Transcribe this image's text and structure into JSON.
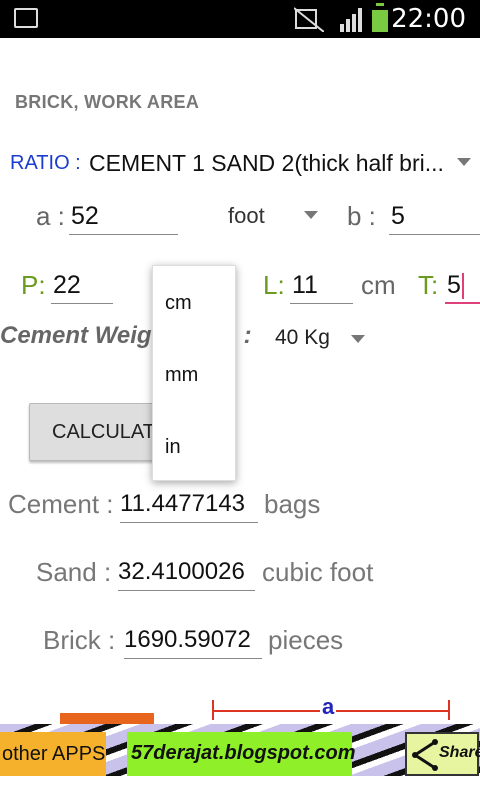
{
  "status_bar": {
    "time": "22:00",
    "battery_color": "#7ac943"
  },
  "title": "BRICK,   WORK AREA",
  "ratio": {
    "label": "RATIO :",
    "value": "CEMENT 1 SAND 2(thick half bri..."
  },
  "dimensions": {
    "a_label": "a :",
    "a_value": "52",
    "unit_value": "foot",
    "b_label": "b  :",
    "b_value": "5"
  },
  "brick_size": {
    "p_label": "P:",
    "p_value": "22",
    "l_label": "L:",
    "l_value": "11",
    "unit_value": "cm",
    "t_label": "T:",
    "t_value": "5"
  },
  "cement_weight": {
    "label": "Cement Weight bags :",
    "value": "40 Kg"
  },
  "calculate_button": "CALCULATE",
  "results": {
    "cement_label": "Cement :",
    "cement_value": "11.4477143",
    "cement_unit": "bags",
    "sand_label": "Sand :",
    "sand_value": "32.4100026",
    "sand_unit": "cubic foot",
    "brick_label": "Brick :",
    "brick_value": "1690.59072",
    "brick_unit": "pieces"
  },
  "unit_popup": {
    "options": [
      "cm",
      "mm",
      "in"
    ]
  },
  "diagram": {
    "label": "a"
  },
  "ad_banner": {
    "other_apps": "other APPS",
    "blog": "57derajat.blogspot.com",
    "share": "Share"
  },
  "colors": {
    "ratio_label": "#1a3ccf",
    "accent_green": "#6a9a1f",
    "active_field": "#e0407a"
  }
}
